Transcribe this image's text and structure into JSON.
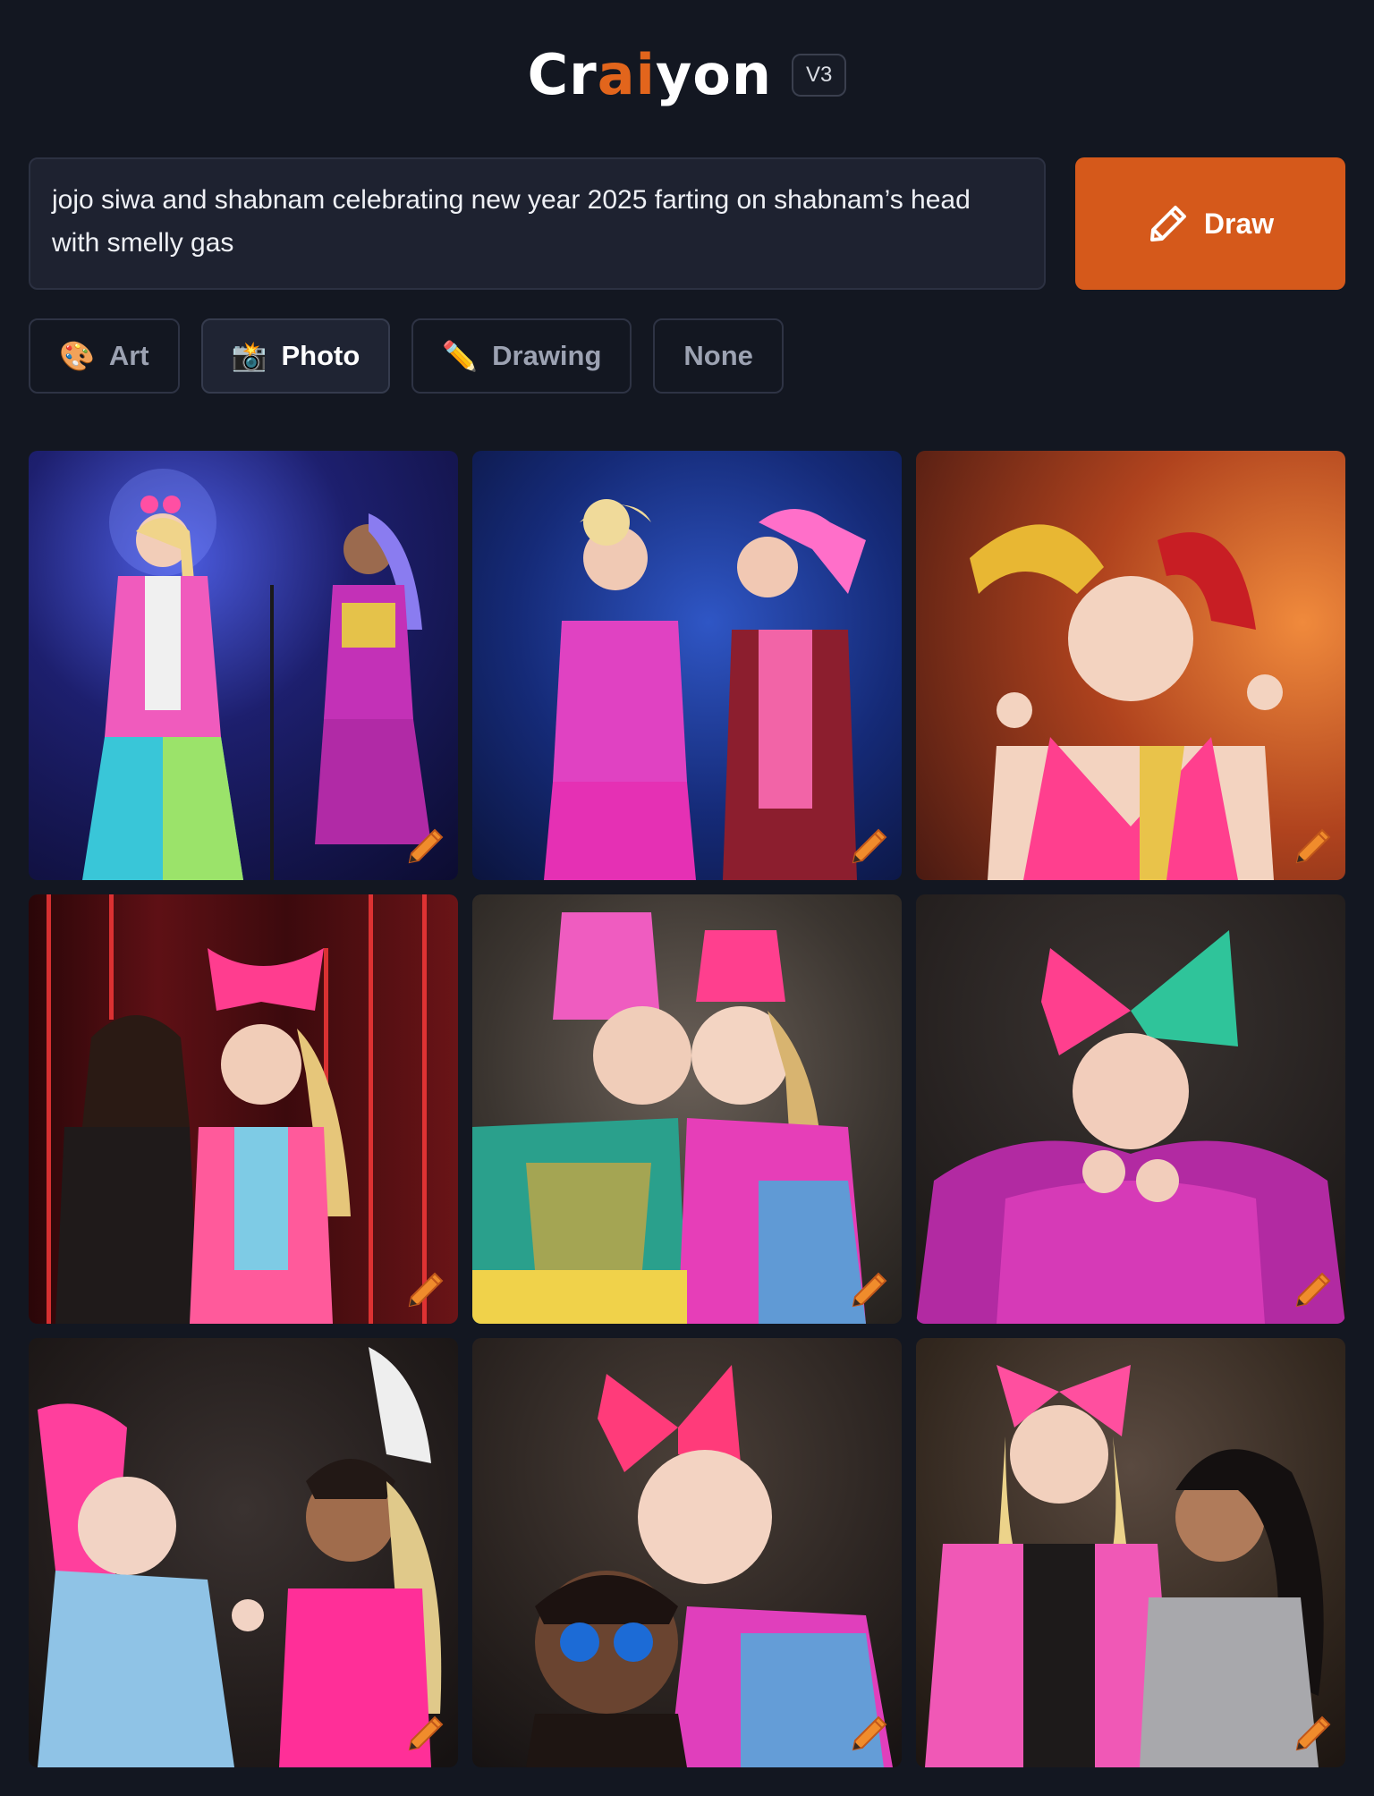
{
  "header": {
    "logo_parts": [
      "Cr",
      "ai",
      "yon"
    ],
    "version": "V3"
  },
  "prompt": {
    "text": "jojo siwa and shabnam celebrating new year 2025 farting on shabnam’s head with smelly gas"
  },
  "draw_button": {
    "label": "Draw",
    "icon": "pencil-icon"
  },
  "styles": [
    {
      "label": "Art",
      "icon": "🎨",
      "active": false
    },
    {
      "label": "Photo",
      "icon": "📸",
      "active": true
    },
    {
      "label": "Drawing",
      "icon": "✏️",
      "active": false
    },
    {
      "label": "None",
      "icon": "",
      "active": false
    }
  ],
  "results": {
    "count": 9,
    "edit_icon": "pencil-edit-icon"
  },
  "colors": {
    "background": "#131721",
    "accent": "#d5591b",
    "logo_accent": "#e2651c",
    "input_bg": "#1e2230"
  }
}
